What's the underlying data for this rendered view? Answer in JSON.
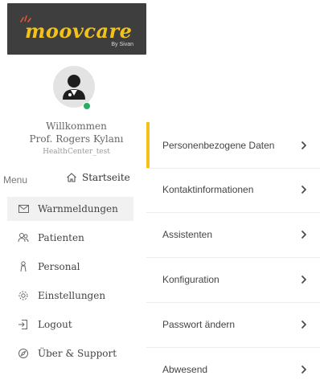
{
  "brand": {
    "name": "moovcare",
    "sub": "By Sivan",
    "accent": "#f3c21a"
  },
  "profile": {
    "welcome": "Willkommen",
    "name": "Prof. Rogers Kylanı",
    "center": "HealthCenter_test",
    "status_color": "#27ae60"
  },
  "menu": {
    "label": "Menu",
    "home": {
      "label": "Startseite",
      "icon": "home-icon"
    },
    "items": [
      {
        "label": "Warnmeldungen",
        "icon": "mail-icon",
        "active": true
      },
      {
        "label": "Patienten",
        "icon": "patients-icon",
        "active": false
      },
      {
        "label": "Personal",
        "icon": "staff-icon",
        "active": false
      },
      {
        "label": "Einstellungen",
        "icon": "gear-icon",
        "active": false
      },
      {
        "label": "Logout",
        "icon": "logout-icon",
        "active": false
      },
      {
        "label": "Über & Support",
        "icon": "compass-icon",
        "active": false
      }
    ]
  },
  "settings": {
    "items": [
      {
        "label": "Personenbezogene Daten",
        "selected": true
      },
      {
        "label": "Kontaktinformationen",
        "selected": false
      },
      {
        "label": "Assistenten",
        "selected": false
      },
      {
        "label": "Konfiguration",
        "selected": false
      },
      {
        "label": "Passwort ändern",
        "selected": false
      },
      {
        "label": "Abwesend",
        "selected": false
      }
    ]
  }
}
